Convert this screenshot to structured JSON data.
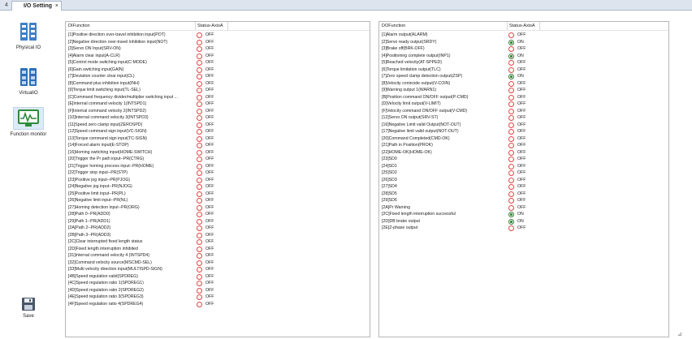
{
  "tabs": {
    "prev_glyph": "4",
    "active_label": "I/O Setting",
    "close_glyph": "×"
  },
  "nav": {
    "items": [
      {
        "label": "Physical IO",
        "icon": "physical-io-icon",
        "active": false
      },
      {
        "label": "VirtualIO",
        "icon": "virtual-io-icon",
        "active": false
      },
      {
        "label": "Function monitor",
        "icon": "function-monitor-icon",
        "active": true
      }
    ],
    "save_label": "Save"
  },
  "colors": {
    "on": "#2c8a2c",
    "off": "#e04646",
    "active_nav": "#dcebf8"
  },
  "di_table": {
    "headers": [
      "DIFunction",
      "Status-AxisA"
    ],
    "rows": [
      {
        "fn": "[1]Positive direction over-travel inhibition input(POT)",
        "status": "OFF"
      },
      {
        "fn": "[2]Negative direction over-travel inhibition input(NOT)",
        "status": "OFF"
      },
      {
        "fn": "[3]Servo ON Input(SRV-ON)",
        "status": "OFF"
      },
      {
        "fn": "[4]Alarm clear input(A-CLR)",
        "status": "OFF"
      },
      {
        "fn": "[5]Control mode switching input(C-MODE)",
        "status": "OFF"
      },
      {
        "fn": "[6]Gain switching input(GAIN)",
        "status": "OFF"
      },
      {
        "fn": "[7]Deviation counter clear input(CL)",
        "status": "OFF"
      },
      {
        "fn": "[8]Command plus inhibition input(INH)",
        "status": "OFF"
      },
      {
        "fn": "[9]Torque limit switching input(TL-SEL)",
        "status": "OFF"
      },
      {
        "fn": "[C]Command frequency divider/multiplier switching input ...",
        "status": "OFF"
      },
      {
        "fn": "[E]Internal command velocity 1(INTSPD1)",
        "status": "OFF"
      },
      {
        "fn": "[F]Internal command velocity 2(INTSPD2)",
        "status": "OFF"
      },
      {
        "fn": "[10]Internal command velocity 3(INTSPD3)",
        "status": "OFF"
      },
      {
        "fn": "[11]Speed zero clamp input(ZEROSPD)",
        "status": "OFF"
      },
      {
        "fn": "[12]Speed command sign input(VC-SIGN)",
        "status": "OFF"
      },
      {
        "fn": "[13]Torque command sign input(TC-SIGN)",
        "status": "OFF"
      },
      {
        "fn": "[14]Forced alarm input(E-STOP)",
        "status": "OFF"
      },
      {
        "fn": "[16]Homing switching input(HOME-SWITCH)",
        "status": "OFF"
      },
      {
        "fn": "[20]Trigger the Pr path input--PR(CTRG)",
        "status": "OFF"
      },
      {
        "fn": "[21]Trigger homing process input--PR(HOME)",
        "status": "OFF"
      },
      {
        "fn": "[22]Trigger stop input--PR(STP)",
        "status": "OFF"
      },
      {
        "fn": "[23]Positive jog input--PR(PJOG)",
        "status": "OFF"
      },
      {
        "fn": "[24]Negative jog input--PR(NJOG)",
        "status": "OFF"
      },
      {
        "fn": "[25]Positive limit input--PR(PL)",
        "status": "OFF"
      },
      {
        "fn": "[26]Negative limit input--PR(NL)",
        "status": "OFF"
      },
      {
        "fn": "[27]Homing detection input--PR(ORG)",
        "status": "OFF"
      },
      {
        "fn": "[28]Path 0--PR(ADD0)",
        "status": "OFF"
      },
      {
        "fn": "[29]Path 1--PR(ADD1)",
        "status": "OFF"
      },
      {
        "fn": "[2A]Path 2--PR(ADD2)",
        "status": "OFF"
      },
      {
        "fn": "[2B]Path 3--PR(ADD3)",
        "status": "OFF"
      },
      {
        "fn": "[2C]Clear interrupted fixed length status",
        "status": "OFF"
      },
      {
        "fn": "[2D]Fixed length interruption inhibited",
        "status": "OFF"
      },
      {
        "fn": "[31]Internal command velocity 4 (INTSPD4)",
        "status": "OFF"
      },
      {
        "fn": "[32]Command velocity source(MSCMD-SEL)",
        "status": "OFF"
      },
      {
        "fn": "[33]Multi velocity direction input(MULTISPD-SIGN)",
        "status": "OFF"
      },
      {
        "fn": "[4B]Speed regulation valid(SPDREG)",
        "status": "OFF"
      },
      {
        "fn": "[4C]Speed regulation ratio 1(SPDREG1)",
        "status": "OFF"
      },
      {
        "fn": "[4D]Speed regulation ratio 2(SPDREG2)",
        "status": "OFF"
      },
      {
        "fn": "[4E]Speed regulation ratio 3(SPDREG3)",
        "status": "OFF"
      },
      {
        "fn": "[4F]Speed regulation ratio 4(SPDREG4)",
        "status": "OFF"
      }
    ]
  },
  "do_table": {
    "headers": [
      "DOFunction",
      "Status-AxisA"
    ],
    "rows": [
      {
        "fn": "[1]Alarm output(ALARM)",
        "status": "OFF"
      },
      {
        "fn": "[2]Servo ready output(SRDY)",
        "status": "ON"
      },
      {
        "fn": "[3]Brake off(BRK-OFF)",
        "status": "OFF"
      },
      {
        "fn": "[4]Positioning complete output(INP1)",
        "status": "ON"
      },
      {
        "fn": "[5]Reached velocity(AT-SPPED)",
        "status": "OFF"
      },
      {
        "fn": "[6]Torque limitation output(TLC)",
        "status": "OFF"
      },
      {
        "fn": "[7]Zero speed clamp detection output(ZSP)",
        "status": "ON"
      },
      {
        "fn": "[8]Velocity conincide output(V-COIN)",
        "status": "OFF"
      },
      {
        "fn": "[9]Warning output 1(WARN1)",
        "status": "OFF"
      },
      {
        "fn": "[B]Position command ON/OFF output(P-CMD)",
        "status": "OFF"
      },
      {
        "fn": "[D]Velocity limit output(V-LIMIT)",
        "status": "OFF"
      },
      {
        "fn": "[F]Velocity command ON/OFF output(V-CMD)",
        "status": "OFF"
      },
      {
        "fn": "[12]Servo ON output(SRV-ST)",
        "status": "OFF"
      },
      {
        "fn": "[16]Negative Limit valid Output(NOT-OUT)",
        "status": "OFF"
      },
      {
        "fn": "[17]Negative limit valid output(NOT-OUT)",
        "status": "OFF"
      },
      {
        "fn": "[20]Command Completed(CMD-OK)",
        "status": "OFF"
      },
      {
        "fn": "[21]Path in Position(PROK)",
        "status": "OFF"
      },
      {
        "fn": "[22]HOME-OK(HOME-OK)",
        "status": "OFF"
      },
      {
        "fn": "[23]SD0",
        "status": "OFF"
      },
      {
        "fn": "[24]SD1",
        "status": "OFF"
      },
      {
        "fn": "[25]SD2",
        "status": "OFF"
      },
      {
        "fn": "[26]SD3",
        "status": "OFF"
      },
      {
        "fn": "[27]SD4",
        "status": "OFF"
      },
      {
        "fn": "[28]SD5",
        "status": "OFF"
      },
      {
        "fn": "[29]SD6",
        "status": "OFF"
      },
      {
        "fn": "[2A]Pr Warning",
        "status": "OFF"
      },
      {
        "fn": "[2C]Fixed length interruption successful",
        "status": "ON"
      },
      {
        "fn": "[2D]DB brake output",
        "status": "ON"
      },
      {
        "fn": "[2E]Z-phase output",
        "status": "OFF"
      }
    ]
  }
}
